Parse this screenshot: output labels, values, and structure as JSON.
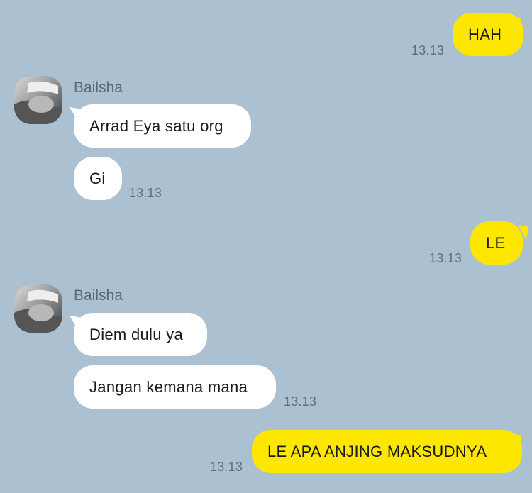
{
  "chat": {
    "colors": {
      "background": "#abc1d1",
      "outgoing_bubble": "#fde600",
      "incoming_bubble": "#ffffff",
      "timestamp": "#5e6f7c"
    },
    "messages": [
      {
        "id": "m1",
        "direction": "out",
        "text": "HAH",
        "time": "13.13"
      },
      {
        "id": "m2",
        "direction": "in",
        "sender": "Bailsha",
        "text": "Arrad Eya satu org"
      },
      {
        "id": "m3",
        "direction": "in",
        "text": "Gi",
        "time": "13.13"
      },
      {
        "id": "m4",
        "direction": "out",
        "text": "LE",
        "time": "13.13"
      },
      {
        "id": "m5",
        "direction": "in",
        "sender": "Bailsha",
        "text": "Diem dulu ya"
      },
      {
        "id": "m6",
        "direction": "in",
        "text": "Jangan kemana mana",
        "time": "13.13"
      },
      {
        "id": "m7",
        "direction": "out",
        "text": "LE APA ANJING MAKSUDNYA",
        "time": "13.13"
      }
    ],
    "avatar_icon": "profile-photo"
  }
}
